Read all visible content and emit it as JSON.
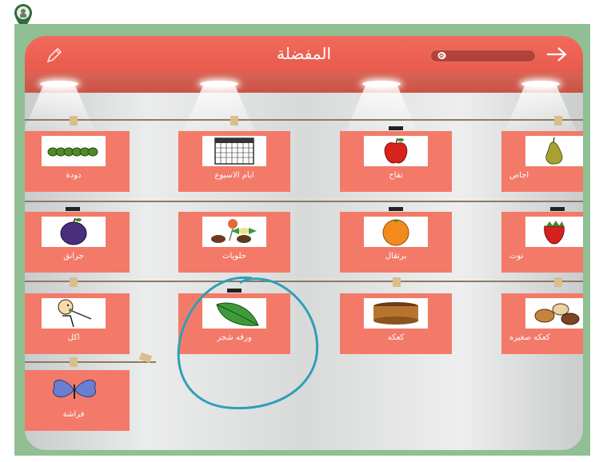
{
  "app": {
    "title": "المفضلة",
    "brand_icon": "avatar-pin-icon"
  },
  "toolbar": {
    "edit_icon": "pencil-icon",
    "search_icon": "search-icon",
    "search_placeholder": "",
    "forward_icon": "arrow-right-icon"
  },
  "colors": {
    "frame": "#8fbf93",
    "topbar": "#f26a5b",
    "card": "#f37a69",
    "annotation": "#2f9fb6"
  },
  "rows": [
    {
      "cards": [
        {
          "label": "دودة",
          "icon": "caterpillar-icon"
        },
        {
          "label": "ايام الاسبوع",
          "icon": "calendar-icon"
        },
        {
          "label": "تفاح",
          "icon": "apple-icon"
        },
        {
          "label": "اجاص",
          "icon": "pear-icon"
        }
      ]
    },
    {
      "cards": [
        {
          "label": "جرانق",
          "icon": "plum-icon"
        },
        {
          "label": "حلويات",
          "icon": "candies-icon"
        },
        {
          "label": "برتقال",
          "icon": "orange-icon"
        },
        {
          "label": "توت",
          "icon": "strawberry-icon"
        }
      ]
    },
    {
      "cards": [
        {
          "label": "اكل",
          "icon": "eating-person-icon"
        },
        {
          "label": "ورقه شجر",
          "icon": "leaf-icon"
        },
        {
          "label": "كعكه",
          "icon": "cake-icon"
        },
        {
          "label": "كعكه صغيره",
          "icon": "cookies-icon"
        }
      ]
    },
    {
      "cards": [
        {
          "label": "فراشة",
          "icon": "butterfly-icon"
        }
      ]
    }
  ]
}
